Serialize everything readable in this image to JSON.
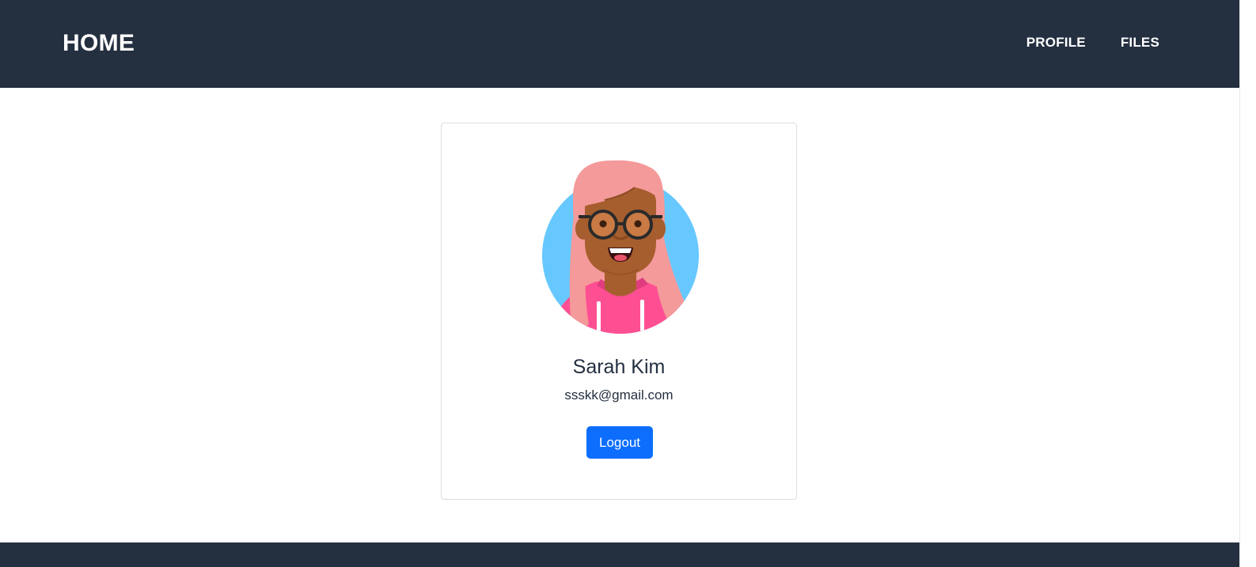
{
  "navbar": {
    "brand": "HOME",
    "links": [
      {
        "label": "PROFILE"
      },
      {
        "label": "FILES"
      }
    ]
  },
  "profile": {
    "name": "Sarah Kim",
    "email": "ssskk@gmail.com",
    "logout_label": "Logout",
    "avatar_icon": "profile-avatar-illustration"
  },
  "colors": {
    "navbar_bg": "#242f40",
    "primary_button": "#0d6efd",
    "avatar_bg": "#66c8ff",
    "hair": "#f49a9a",
    "shirt": "#ff4f93",
    "skin": "#a65e2e"
  }
}
